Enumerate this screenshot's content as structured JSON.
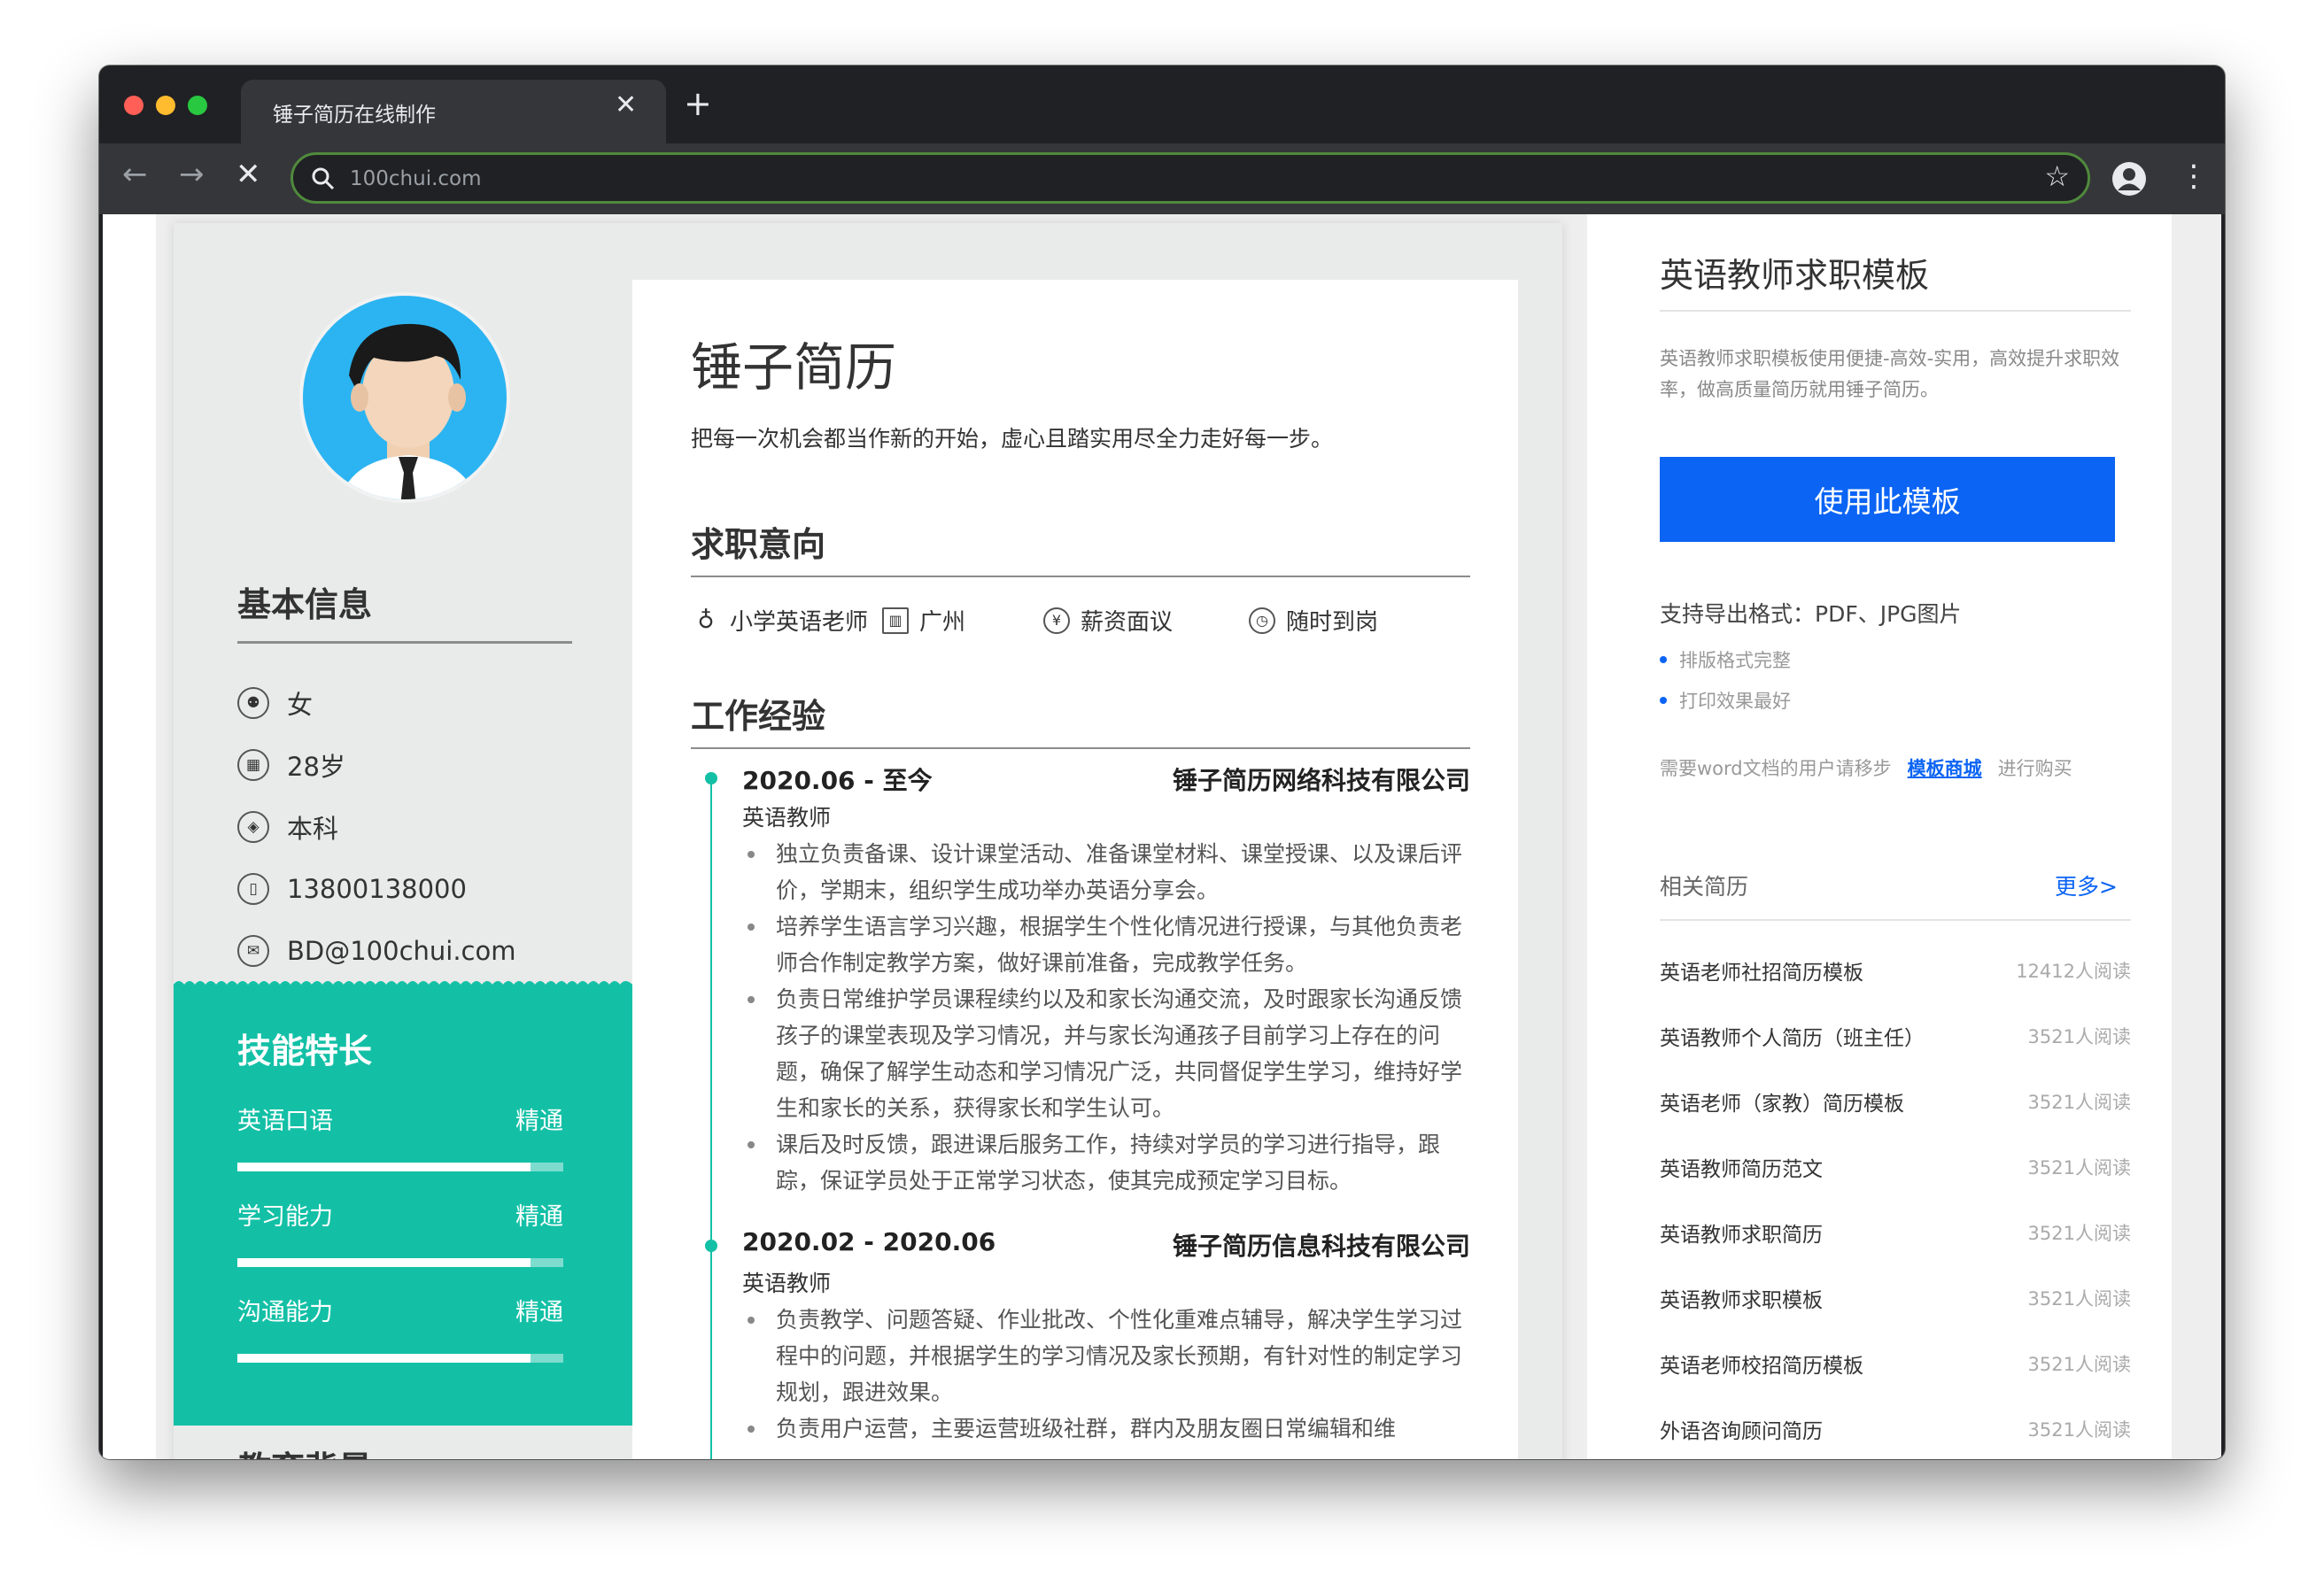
{
  "browser": {
    "tab_title": "锤子简历在线制作",
    "tab_close": "✕",
    "new_tab": "+",
    "url": "100chui.com",
    "back": "←",
    "forward": "→",
    "stop": "✕",
    "star": "☆",
    "menu": "⋮"
  },
  "resume": {
    "name": "锤子简历",
    "motto": "把每一次机会都当作新的开始，虚心且踏实用尽全力走好每一步。",
    "basic": {
      "heading": "基本信息",
      "items": [
        {
          "icon": "gender-icon",
          "text": "女"
        },
        {
          "icon": "age-icon",
          "text": "28岁"
        },
        {
          "icon": "education-icon",
          "text": "本科"
        },
        {
          "icon": "phone-icon",
          "text": "13800138000"
        },
        {
          "icon": "email-icon",
          "text": "BD@100chui.com"
        }
      ]
    },
    "skills": {
      "heading": "技能特长",
      "items": [
        {
          "name": "英语口语",
          "level": "精通",
          "percent": 90
        },
        {
          "name": "学习能力",
          "level": "精通",
          "percent": 90
        },
        {
          "name": "沟通能力",
          "level": "精通",
          "percent": 90
        }
      ]
    },
    "education_heading": "教育背景",
    "intent": {
      "heading": "求职意向",
      "items": [
        {
          "icon": "tie-icon",
          "text": "小学英语老师"
        },
        {
          "icon": "building-icon",
          "text": "广州"
        },
        {
          "icon": "yen-icon",
          "text": "薪资面议"
        },
        {
          "icon": "clock-icon",
          "text": "随时到岗"
        }
      ]
    },
    "work": {
      "heading": "工作经验",
      "jobs": [
        {
          "date": "2020.06 - 至今",
          "company": "锤子简历网络科技有限公司",
          "role": "英语教师",
          "bullets": [
            "独立负责备课、设计课堂活动、准备课堂材料、课堂授课、以及课后评价，学期末，组织学生成功举办英语分享会。",
            "培养学生语言学习兴趣，根据学生个性化情况进行授课，与其他负责老师合作制定教学方案，做好课前准备，完成教学任务。",
            "负责日常维护学员课程续约以及和家长沟通交流，及时跟家长沟通反馈孩子的课堂表现及学习情况，并与家长沟通孩子目前学习上存在的问题，确保了解学生动态和学习情况广泛，共同督促学生学习，维持好学生和家长的关系，获得家长和学生认可。",
            "课后及时反馈，跟进课后服务工作，持续对学员的学习进行指导，跟踪，保证学员处于正常学习状态，使其完成预定学习目标。"
          ]
        },
        {
          "date": "2020.02 - 2020.06",
          "company": "锤子简历信息科技有限公司",
          "role": "英语教师",
          "bullets": [
            "负责教学、问题答疑、作业批改、个性化重难点辅导，解决学生学习过程中的问题，并根据学生的学习情况及家长预期，有针对性的制定学习规划，跟进效果。",
            "负责用户运营，主要运营班级社群，群内及朋友圈日常编辑和维"
          ]
        }
      ]
    }
  },
  "sidebar": {
    "title": "英语教师求职模板",
    "description": "英语教师求职模板使用便捷-高效-实用，高效提升求职效率，做高质量简历就用锤子简历。",
    "use_button": "使用此模板",
    "export_formats": "支持导出格式：PDF、JPG图片",
    "features": [
      "排版格式完整",
      "打印效果最好"
    ],
    "word_prefix": "需要word文档的用户请移步",
    "word_link": "模板商城",
    "word_suffix": "进行购买",
    "related_heading": "相关简历",
    "more_link": "更多>",
    "related": [
      {
        "title": "英语老师社招简历模板",
        "count": "12412人阅读"
      },
      {
        "title": "英语教师个人简历（班主任）",
        "count": "3521人阅读"
      },
      {
        "title": "英语老师（家教）简历模板",
        "count": "3521人阅读"
      },
      {
        "title": "英语教师简历范文",
        "count": "3521人阅读"
      },
      {
        "title": "英语教师求职简历",
        "count": "3521人阅读"
      },
      {
        "title": "英语教师求职模板",
        "count": "3521人阅读"
      },
      {
        "title": "英语老师校招简历模板",
        "count": "3521人阅读"
      },
      {
        "title": "外语咨询顾问简历",
        "count": "3521人阅读"
      }
    ]
  },
  "colors": {
    "accent_teal": "#13c0a6",
    "primary_blue": "#0b64f4",
    "chrome_dark": "#202124",
    "traffic_red": "#ff5f57",
    "traffic_yellow": "#febc2e",
    "traffic_green": "#28c840"
  }
}
